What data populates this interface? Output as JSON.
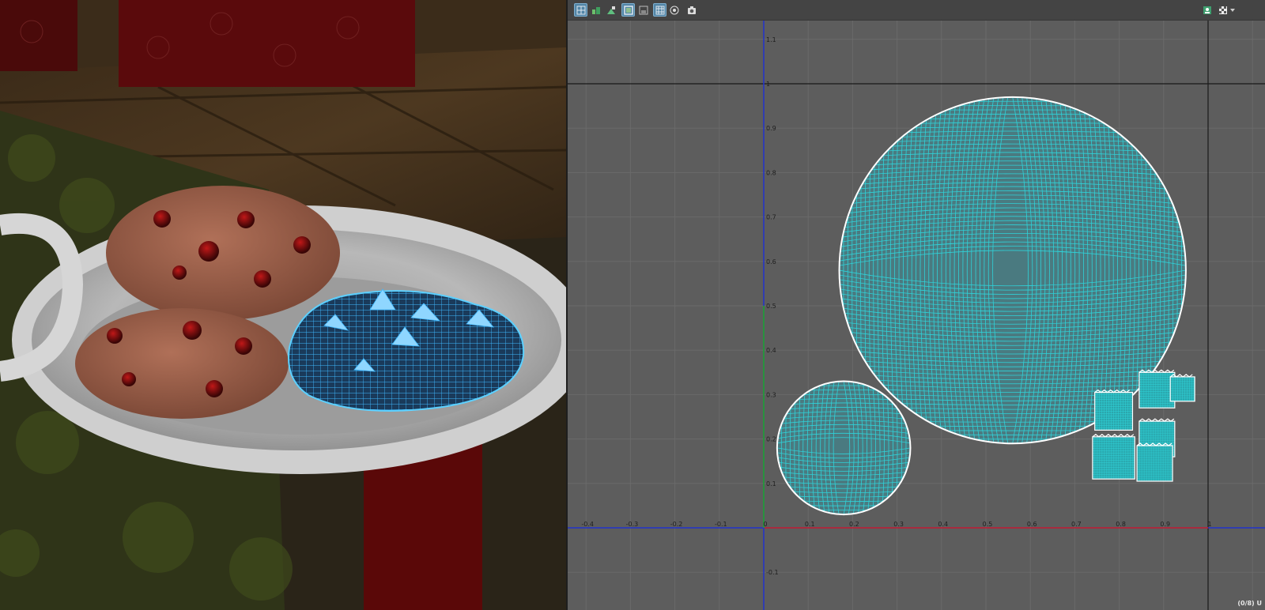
{
  "uv_editor": {
    "toolbar": {
      "left_buttons": [
        {
          "name": "uv-grid-toggle-icon",
          "active": true
        },
        {
          "name": "uv-shell-green-icon",
          "active": false
        },
        {
          "name": "uv-shell-alt-icon",
          "active": false
        },
        {
          "name": "uv-texture-frame-icon",
          "active": true
        },
        {
          "name": "uv-frame-alt-icon",
          "active": false
        },
        {
          "name": "uv-grid-snap-icon",
          "active": true
        },
        {
          "name": "uv-pivot-icon",
          "active": false
        },
        {
          "name": "uv-snapshot-icon",
          "active": false
        }
      ],
      "right_buttons": [
        {
          "name": "uv-image-display-icon",
          "active": false
        },
        {
          "name": "uv-checker-icon",
          "active": false
        },
        {
          "name": "uv-dropdown-arrow-icon",
          "active": false
        }
      ]
    },
    "x_ticks": [
      "-0.4",
      "-0.3",
      "-0.2",
      "-0.1",
      "0",
      "0.1",
      "0.2",
      "0.3",
      "0.4",
      "0.5",
      "0.6",
      "0.7",
      "0.8",
      "0.9",
      "1"
    ],
    "y_ticks": [
      "1.1",
      "1",
      "0.9",
      "0.8",
      "0.7",
      "0.6",
      "0.5",
      "0.4",
      "0.3",
      "0.2",
      "0.1",
      "-0.1"
    ],
    "status_text": "(0/8) U",
    "colors": {
      "background": "#5d5d5d",
      "grid": "#6a6a6a",
      "uv_mesh": "#2fd2d8",
      "shell_border": "#ffffff",
      "u_axis": "#cc2222",
      "v_axis": "#22aa22",
      "origin_axis": "#2233cc"
    },
    "uv_shells": [
      {
        "name": "cookie-top-shell",
        "shape": "circle",
        "center_u": 0.56,
        "center_v": 0.58,
        "radius": 0.39
      },
      {
        "name": "cookie-bottom-shell",
        "shape": "circle",
        "center_u": 0.18,
        "center_v": 0.18,
        "radius": 0.15
      },
      {
        "name": "chip-shell-1",
        "shape": "square",
        "u": 0.745,
        "v": 0.22,
        "size": 0.085
      },
      {
        "name": "chip-shell-2",
        "shape": "square",
        "u": 0.845,
        "v": 0.27,
        "size": 0.08
      },
      {
        "name": "chip-shell-3",
        "shape": "square",
        "u": 0.915,
        "v": 0.285,
        "size": 0.055
      },
      {
        "name": "chip-shell-4",
        "shape": "square",
        "u": 0.845,
        "v": 0.16,
        "size": 0.08
      },
      {
        "name": "chip-shell-5",
        "shape": "square",
        "u": 0.74,
        "v": 0.11,
        "size": 0.095
      },
      {
        "name": "chip-shell-6",
        "shape": "square",
        "u": 0.84,
        "v": 0.105,
        "size": 0.08
      }
    ]
  }
}
